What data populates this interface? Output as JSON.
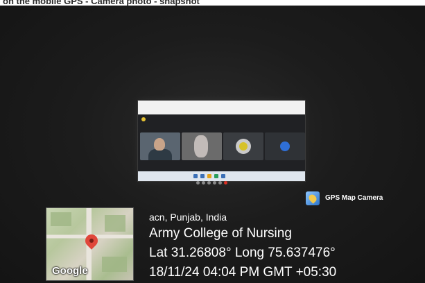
{
  "caption": {
    "text": "on the mobile GPS - Camera photo - snapshot"
  },
  "watermark": {
    "app_name": "GPS Map Camera",
    "icon": "gps-map-camera-icon"
  },
  "map": {
    "provider_logo": "Google",
    "pin_icon": "map-pin-icon"
  },
  "location": {
    "region": "acn, Punjab, India",
    "place": "Army College of Nursing",
    "coordinates": "Lat 31.26808° Long 75.637476°",
    "datetime": "18/11/24 04:04 PM GMT +05:30"
  },
  "colors": {
    "overlay_text": "#ffffff",
    "pin": "#e0463a",
    "meet_background": "#202124"
  }
}
